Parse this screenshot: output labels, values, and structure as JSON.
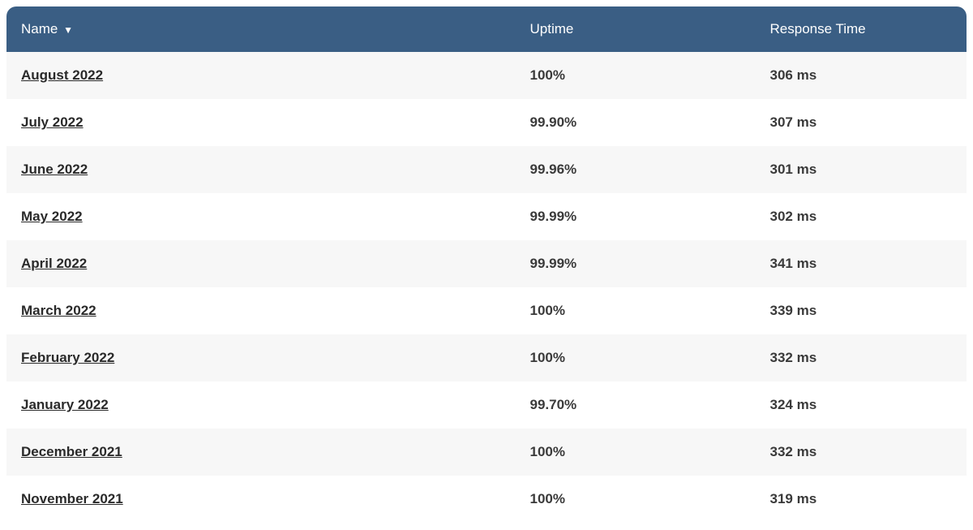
{
  "table": {
    "headers": {
      "name": "Name",
      "sort_indicator": "▼",
      "uptime": "Uptime",
      "response_time": "Response Time"
    },
    "rows": [
      {
        "name": "August 2022",
        "uptime": "100%",
        "response_time": "306 ms"
      },
      {
        "name": "July 2022",
        "uptime": "99.90%",
        "response_time": "307 ms"
      },
      {
        "name": "June 2022",
        "uptime": "99.96%",
        "response_time": "301 ms"
      },
      {
        "name": "May 2022",
        "uptime": "99.99%",
        "response_time": "302 ms"
      },
      {
        "name": "April 2022",
        "uptime": "99.99%",
        "response_time": "341 ms"
      },
      {
        "name": "March 2022",
        "uptime": "100%",
        "response_time": "339 ms"
      },
      {
        "name": "February 2022",
        "uptime": "100%",
        "response_time": "332 ms"
      },
      {
        "name": "January 2022",
        "uptime": "99.70%",
        "response_time": "324 ms"
      },
      {
        "name": "December 2021",
        "uptime": "100%",
        "response_time": "332 ms"
      },
      {
        "name": "November 2021",
        "uptime": "100%",
        "response_time": "319 ms"
      }
    ]
  }
}
